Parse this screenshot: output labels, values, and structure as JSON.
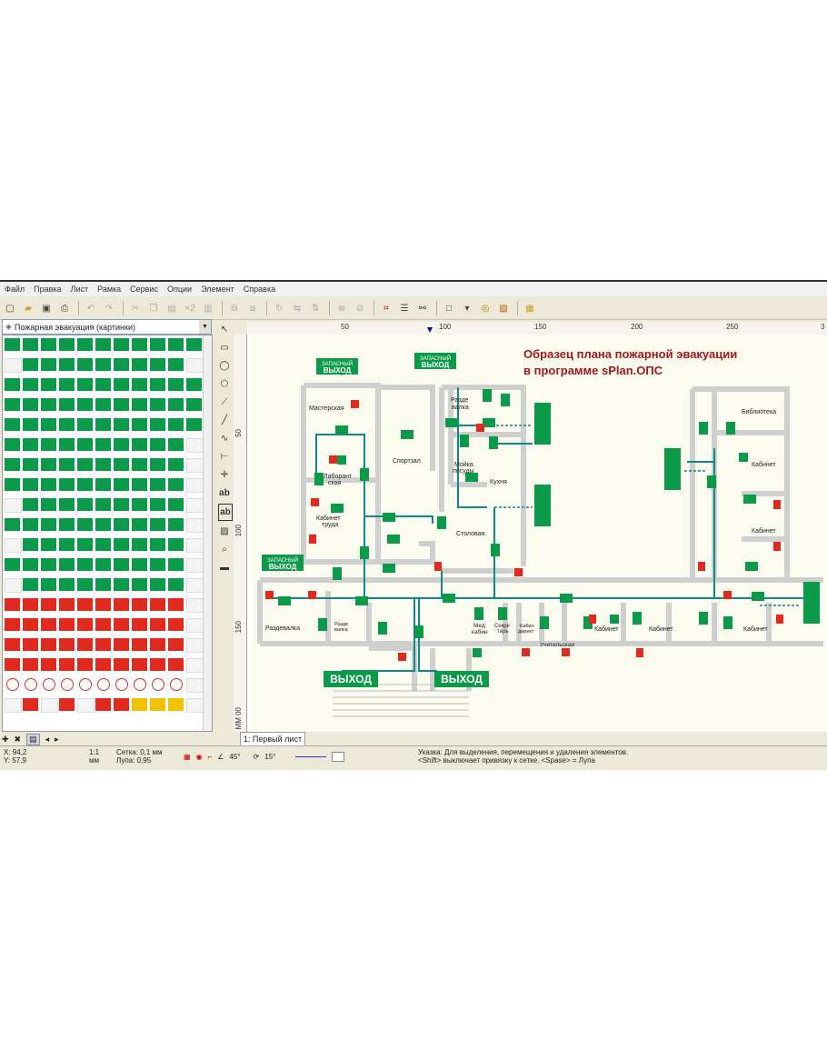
{
  "menu": [
    "Файл",
    "Правка",
    "Лист",
    "Рамка",
    "Сервис",
    "Опции",
    "Элемент",
    "Справка"
  ],
  "library": {
    "selected": "Пожарная эвакуация (картинки)"
  },
  "ruler": {
    "top": [
      "50",
      "100",
      "150",
      "200",
      "250",
      "3"
    ],
    "left": [
      "50",
      "100",
      "150",
      "ММ 00"
    ]
  },
  "sheet_tab": "1: Первый лист",
  "plan": {
    "title_line1": "Образец плана пожарной эвакуации",
    "title_line2": "в программе sPlan.ОПС",
    "exit_big": "ВЫХОД",
    "exit_spare_1": "ЗАПАСНЫЙ",
    "exit_spare_2": "ВЫХОД",
    "rooms": {
      "masterskaya": "Мастерская",
      "laborantskaya_1": "Лаборант",
      "laborantskaya_2": "ская",
      "sportzal": "Спортзал",
      "razdevalka_top_1": "Разде",
      "razdevalka_top_2": "валка",
      "moika_1": "Мойка",
      "moika_2": "посуды",
      "kuhnya": "Кухня",
      "kabinet_truda_1": "Кабинет",
      "kabinet_truda_2": "труда",
      "stolovaya": "Столовая",
      "razdevalka": "Раздевалка",
      "razdevalka_small_1": "Разде",
      "razdevalka_small_2": "валка",
      "med_1": "Мед",
      "med_2": "кабин",
      "sekretar_1": "Секре",
      "sekretar_2": "тарь",
      "kab_dir_1": "Кабин",
      "kab_dir_2": "директ",
      "uchitelskaya": "Учительская",
      "kabinet": "Кабинет",
      "biblioteka": "Библиотека"
    }
  },
  "status": {
    "x": "X: 94,2",
    "y": "Y: 57,9",
    "scale": "1:1",
    "unit": "мм",
    "grid": "Сетка:  0,1 мм",
    "zoom": "Лупа:   0,95",
    "angle1": "45°",
    "angle2": "15°",
    "hint1": "Указка: Для выделения, перемещения и удаления элементов.",
    "hint2": "<Shift> выключает привязку к сетке. <Spase> = Лупа"
  },
  "colors": {
    "green": "#0b9a4a",
    "red": "#e02a20",
    "wall": "#cfcfcf",
    "path": "#0e8a8a",
    "title": "#a01818"
  }
}
